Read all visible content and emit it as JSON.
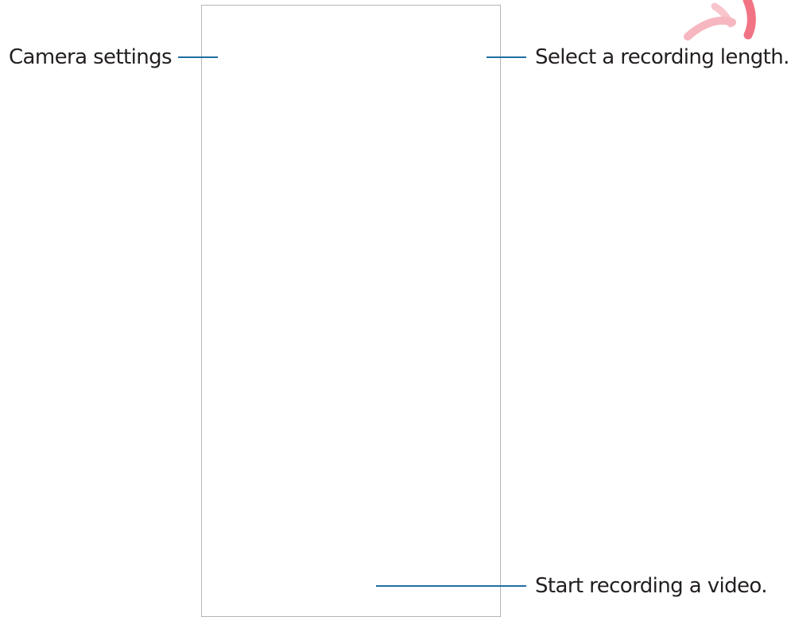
{
  "callouts": {
    "camera_settings": "Camera settings",
    "recording_length": "Select a recording length.",
    "start_recording": "Start recording a video."
  },
  "colors": {
    "leader_line": "#1f6fa3",
    "frame_border": "#b5b5b5",
    "text": "#231f20",
    "watermark": "#ef5a6f"
  },
  "icons": {
    "watermark": "watermark-arc-icon"
  }
}
